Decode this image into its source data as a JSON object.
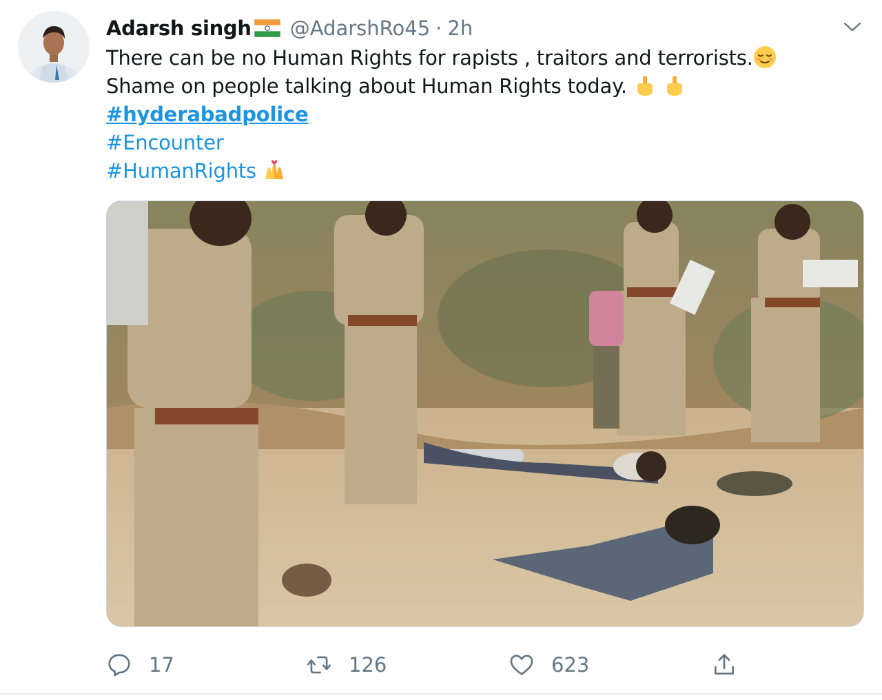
{
  "tweet": {
    "author": {
      "display_name": "Adarsh singh",
      "flag_icon": "india-flag-icon",
      "handle": "@AdarshRo45",
      "separator": "·",
      "time": "2h"
    },
    "text_lines": [
      "There can be no Human Rights for rapists , traitors and terrorists.",
      "Shame on people talking about Human Rights today."
    ],
    "hashtags": [
      "#hyderabadpolice",
      "#Encounter",
      "#HumanRights"
    ],
    "emoji": {
      "line1": "relieved-face-emoji",
      "line2": "middle-finger-emoji",
      "hashtag3": "raising-hands-emoji"
    },
    "media": {
      "icon": "photo"
    },
    "actions": {
      "reply_count": "17",
      "retweet_count": "126",
      "like_count": "623"
    },
    "colors": {
      "link": "#1b95e0",
      "secondary": "#657786",
      "text": "#14171a",
      "border": "#e6ecf0"
    }
  }
}
